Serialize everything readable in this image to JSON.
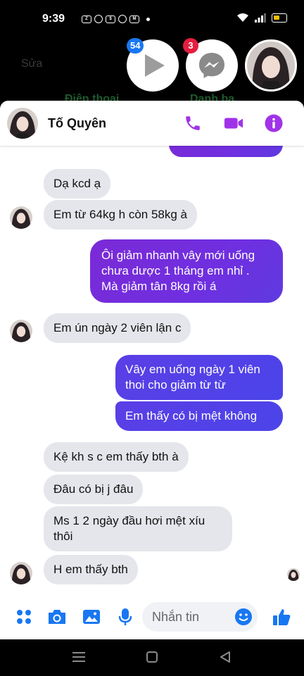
{
  "status_bar": {
    "time": "9:39",
    "app_icons": [
      "zalo-icon",
      "messenger-icon",
      "store-icon",
      "clock-icon",
      "mbh-icon"
    ]
  },
  "background_app": {
    "edit_label": "Sửa",
    "tab_left": "Điện thoại",
    "tab_right": "Danh bạ"
  },
  "chat_heads": [
    {
      "icon": "play-icon",
      "badge": "54",
      "badge_color": "#1877f2"
    },
    {
      "icon": "messenger-icon",
      "badge": "3",
      "badge_color": "#e41e3f"
    },
    {
      "icon": "profile-photo"
    }
  ],
  "header": {
    "contact_name": "Tố Quyên",
    "accent": "#a033e8"
  },
  "messages": [
    {
      "side": "in",
      "text": "Dạ kcd ạ"
    },
    {
      "side": "in",
      "text": "Em từ 64kg h còn 58kg à"
    },
    {
      "side": "out",
      "lines": [
        "Ôi giảm nhanh vây mới uống",
        "chưa dược 1 tháng em nhỉ .",
        "Mà giảm tân 8kg rồi á"
      ]
    },
    {
      "side": "in",
      "text": "Em ún ngày 2 viên lận c"
    },
    {
      "side": "out",
      "lines": [
        "Vây em uống ngày 1 viên",
        "thoi cho giảm từ từ"
      ]
    },
    {
      "side": "out",
      "text": "Em thấy có bị mệt không"
    },
    {
      "side": "in",
      "text": "Kệ kh s c em thấy bth à"
    },
    {
      "side": "in",
      "text": "Đâu có bị j đâu"
    },
    {
      "side": "in",
      "lines": [
        "Ms 1 2 ngày đầu hơi mệt xíu",
        "thôi"
      ]
    },
    {
      "side": "in",
      "text": "H em thấy bth"
    }
  ],
  "composer": {
    "placeholder": "Nhắn tin",
    "accent": "#1877f2"
  },
  "colors": {
    "out_bubble": "#7a2ee0",
    "in_bubble": "#e4e6eb"
  }
}
